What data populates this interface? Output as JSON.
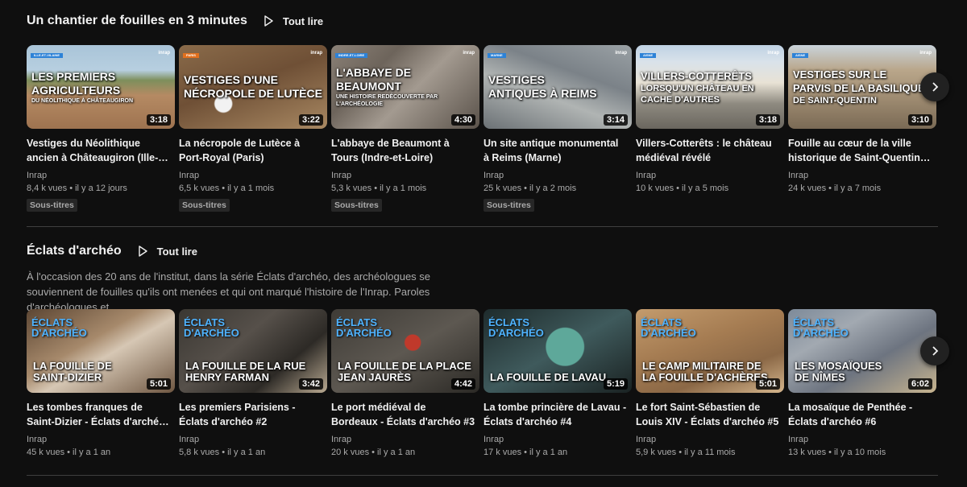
{
  "shelves": [
    {
      "title": "Un chantier de fouilles en 3 minutes",
      "play_all_label": "Tout lire",
      "videos": [
        {
          "title": "Vestiges du Néolithique\nancien à Châteaugiron (Ille-…",
          "channel": "Inrap",
          "meta": "8,4 k vues • il y a 12 jours",
          "badge": "Sous-titres",
          "duration": "3:18",
          "thumb_tag": "ILLE-ET-VILAINE",
          "thumb_lines": [
            "LES PREMIERS",
            "AGRICULTEURS"
          ],
          "thumb_sub": "DU NÉOLITHIQUE À CHÂTEAUGIRON"
        },
        {
          "title": "La nécropole de Lutèce à\nPort-Royal (Paris)",
          "channel": "Inrap",
          "meta": "6,5 k vues • il y a 1 mois",
          "badge": "Sous-titres",
          "duration": "3:22",
          "thumb_tag": "PARIS",
          "thumb_lines": [
            "VESTIGES D'UNE",
            "NÉCROPOLE DE LUTÈCE"
          ],
          "thumb_sub": ""
        },
        {
          "title": "L'abbaye de Beaumont à\nTours (Indre-et-Loire)",
          "channel": "Inrap",
          "meta": "5,3 k vues • il y a 1 mois",
          "badge": "Sous-titres",
          "duration": "4:30",
          "thumb_tag": "INDRE-ET-LOIRE",
          "thumb_lines": [
            "L'ABBAYE DE",
            "BEAUMONT"
          ],
          "thumb_sub": "UNE HISTOIRE REDÉCOUVERTE PAR L'ARCHÉOLOGIE"
        },
        {
          "title": "Un site antique monumental\nà Reims (Marne)",
          "channel": "Inrap",
          "meta": "25 k vues • il y a 2 mois",
          "badge": "Sous-titres",
          "duration": "3:14",
          "thumb_tag": "MARNE",
          "thumb_lines": [
            "VESTIGES",
            "ANTIQUES À REIMS"
          ],
          "thumb_sub": ""
        },
        {
          "title": "Villers-Cotterêts : le château\nmédiéval révélé",
          "channel": "Inrap",
          "meta": "10 k vues • il y a 5 mois",
          "badge": "",
          "duration": "3:18",
          "thumb_tag": "AISNE",
          "thumb_lines": [
            "VILLERS-COTTERÊTS"
          ],
          "thumb_sub": "LORSQU'UN CHÂTEAU EN CACHE D'AUTRES"
        },
        {
          "title": "Fouille au cœur de la ville\nhistorique de Saint-Quentin…",
          "channel": "Inrap",
          "meta": "24 k vues • il y a 7 mois",
          "badge": "",
          "duration": "3:10",
          "thumb_tag": "AISNE",
          "thumb_lines": [
            "VESTIGES SUR LE",
            "PARVIS DE LA BASILIQUE"
          ],
          "thumb_sub": "DE SAINT-QUENTIN"
        }
      ]
    },
    {
      "title": "Éclats d'archéo",
      "play_all_label": "Tout lire",
      "description": "À l'occasion des 20 ans de l'institut, dans la série Éclats d'archéo, des archéologues se souviennent de fouilles qu'ils ont menées et qui ont marqué l'histoire de l'Inrap. Paroles d'archéologues et…",
      "videos": [
        {
          "title": "Les tombes franques de\nSaint-Dizier - Éclats d'arché…",
          "channel": "Inrap",
          "meta": "45 k vues • il y a 1 an",
          "duration": "5:01",
          "logo": "ÉCLATS D'ARCHÉO",
          "thumb_lines": [
            "LA FOUILLE DE",
            "SAINT-DIZIER"
          ]
        },
        {
          "title": "Les premiers Parisiens -\nÉclats d'archéo #2",
          "channel": "Inrap",
          "meta": "5,8 k vues • il y a 1 an",
          "duration": "3:42",
          "logo": "ÉCLATS D'ARCHÉO",
          "thumb_lines": [
            "LA FOUILLE DE LA RUE",
            "HENRY FARMAN"
          ]
        },
        {
          "title": "Le port médiéval de\nBordeaux - Éclats d'archéo #3",
          "channel": "Inrap",
          "meta": "20 k vues • il y a 1 an",
          "duration": "4:42",
          "logo": "ÉCLATS D'ARCHÉO",
          "thumb_lines": [
            "LA FOUILLE DE LA PLACE",
            "JEAN JAURÈS"
          ]
        },
        {
          "title": "La tombe princière de Lavau -\nÉclats d'archéo #4",
          "channel": "Inrap",
          "meta": "17 k vues • il y a 1 an",
          "duration": "5:19",
          "logo": "ÉCLATS D'ARCHÉO",
          "thumb_lines": [
            "LA FOUILLE DE LAVAU"
          ]
        },
        {
          "title": "Le fort Saint-Sébastien de\nLouis XIV - Éclats d'archéo #5",
          "channel": "Inrap",
          "meta": "5,9 k vues • il y a 11 mois",
          "duration": "5:01",
          "logo": "ÉCLATS D'ARCHÉO",
          "thumb_lines": [
            "LE CAMP MILITAIRE DE",
            "LA FOUILLE D'ACHÈRES"
          ]
        },
        {
          "title": "La mosaïque de Penthée -\nÉclats d'archéo #6",
          "channel": "Inrap",
          "meta": "13 k vues • il y a 10 mois",
          "duration": "6:02",
          "logo": "ÉCLATS D'ARCHÉO",
          "thumb_lines": [
            "LES MOSAÏQUES",
            "DE NÎMES"
          ]
        }
      ]
    }
  ],
  "icons": {
    "play_all": "play-outline-icon",
    "next": "chevron-right-icon"
  },
  "colors": {
    "background": "#0f0f0f",
    "text": "#f1f1f1",
    "secondary": "#aaaaaa",
    "badge_bg": "#272727",
    "eclats_blue": "#4fb3ff"
  }
}
